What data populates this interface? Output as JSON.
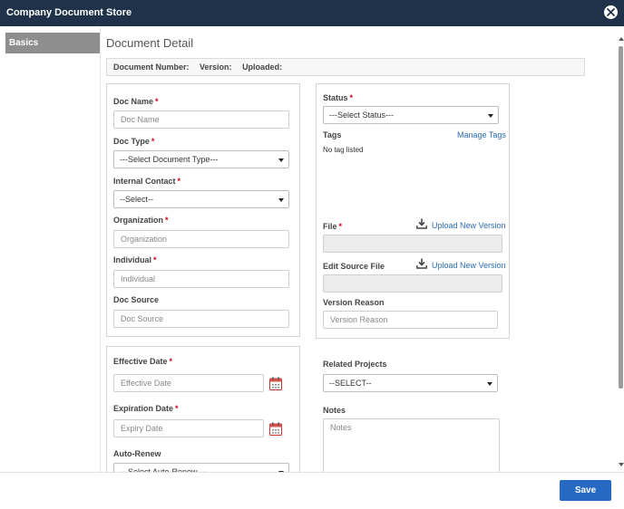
{
  "window": {
    "title": "Company Document Store"
  },
  "sidebar": {
    "tabs": [
      {
        "label": "Basics"
      }
    ]
  },
  "main": {
    "title": "Document Detail",
    "info": {
      "doc_number_label": "Document Number:",
      "version_label": "Version:",
      "uploaded_label": "Uploaded:"
    }
  },
  "form": {
    "doc_name": {
      "label": "Doc Name",
      "placeholder": "Doc Name",
      "required": "*"
    },
    "doc_type": {
      "label": "Doc Type",
      "value": "---Select Document Type---",
      "required": "*"
    },
    "internal_contact": {
      "label": "Internal Contact",
      "value": "--Select--",
      "required": "*"
    },
    "organization": {
      "label": "Organization",
      "placeholder": "Organization",
      "required": "*"
    },
    "individual": {
      "label": "Individual",
      "placeholder": "Individual",
      "required": "*"
    },
    "doc_source": {
      "label": "Doc Source",
      "placeholder": "Doc Source"
    },
    "status": {
      "label": "Status",
      "value": "---Select Status---",
      "required": "*"
    },
    "tags": {
      "label": "Tags",
      "manage_link": "Manage Tags",
      "empty_text": "No tag listed"
    },
    "file": {
      "label": "File",
      "required": "*",
      "upload_link": "Upload New Version"
    },
    "edit_source_file": {
      "label": "Edit Source File",
      "upload_link": "Upload New Version"
    },
    "version_reason": {
      "label": "Version Reason",
      "placeholder": "Version Reason"
    },
    "effective_date": {
      "label": "Effective Date",
      "placeholder": "Effective Date",
      "required": "*"
    },
    "expiration_date": {
      "label": "Expiration Date",
      "placeholder": "Expiry Date",
      "required": "*"
    },
    "auto_renew": {
      "label": "Auto-Renew",
      "value": "---Select Auto-Renew---"
    },
    "related_projects": {
      "label": "Related Projects",
      "value": "--SELECT--"
    },
    "notes": {
      "label": "Notes",
      "placeholder": "Notes"
    }
  },
  "footer": {
    "save_label": "Save"
  },
  "colors": {
    "titlebar": "#1f3249",
    "primary_button": "#2569c3",
    "link": "#2a6db5",
    "required": "#d0021b"
  },
  "icons": {
    "close": "close-icon",
    "calendar": "calendar-icon",
    "download": "download-icon"
  }
}
